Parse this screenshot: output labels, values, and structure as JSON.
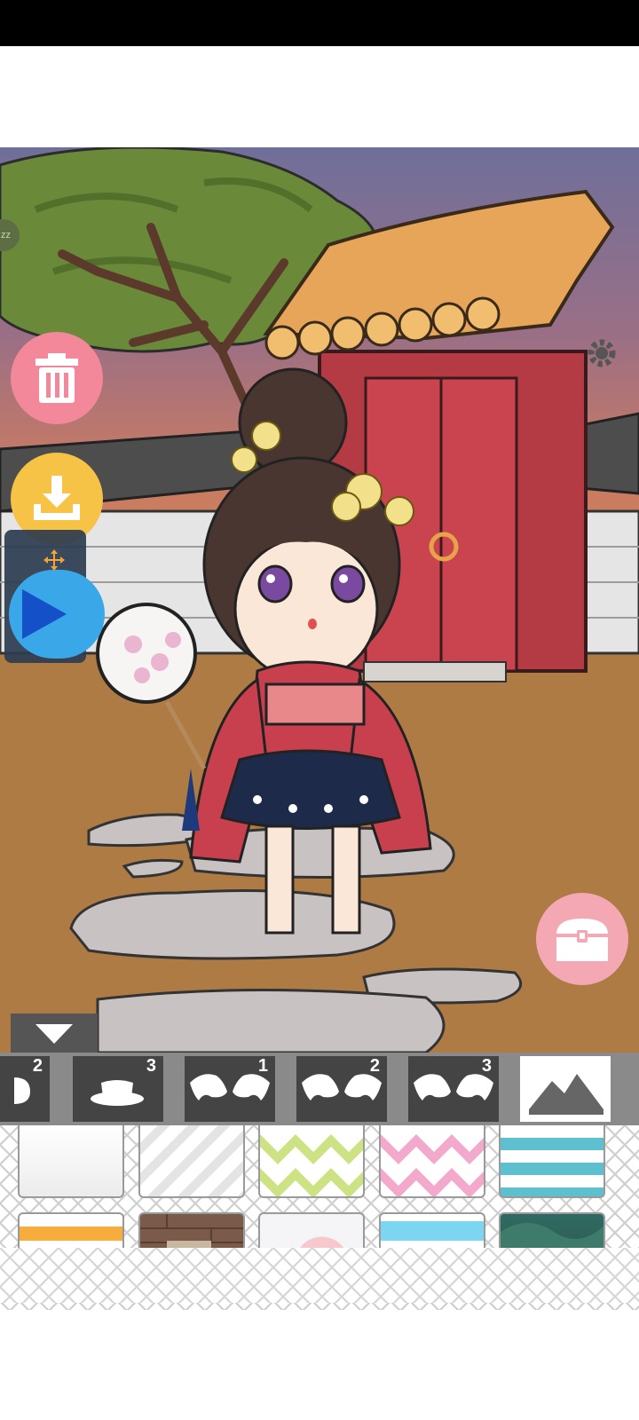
{
  "app": {
    "sleep_badge": "zz"
  },
  "colors": {
    "trash_button": "#f2889a",
    "download_button": "#f6c347",
    "play_button": "#3aa7e8",
    "chest_button": "#f4a8b3",
    "tab_bar": "#8a8a8a",
    "tab_inactive": "#444444",
    "tab_active": "#ffffff"
  },
  "icons": {
    "trash": "trash-icon",
    "download": "download-icon",
    "play": "play-icon",
    "move": "move-arrows-icon",
    "chest": "treasure-chest-icon",
    "settings": "gear-icon",
    "collapse": "chevron-down-icon",
    "background_tab": "landscape-icon"
  },
  "tabs": [
    {
      "id": "tab-partial",
      "icon": "partial-item-icon",
      "count": "2"
    },
    {
      "id": "tab-hat",
      "icon": "hat-icon",
      "count": "3"
    },
    {
      "id": "tab-wings-1",
      "icon": "bat-wings-icon",
      "count": "1"
    },
    {
      "id": "tab-wings-2",
      "icon": "bat-wings-icon",
      "count": "2"
    },
    {
      "id": "tab-wings-3",
      "icon": "bat-wings-icon",
      "count": "3"
    },
    {
      "id": "tab-background",
      "icon": "landscape-icon",
      "count": "",
      "active": true
    }
  ],
  "background_options": [
    {
      "name": "plain-white-gradient"
    },
    {
      "name": "white-diagonal-stripes"
    },
    {
      "name": "green-zigzag"
    },
    {
      "name": "pink-zigzag"
    },
    {
      "name": "teal-stripes"
    },
    {
      "name": "orange-band"
    },
    {
      "name": "brick-room"
    },
    {
      "name": "pink-cloud"
    },
    {
      "name": "sky-blue"
    },
    {
      "name": "jungle"
    }
  ]
}
